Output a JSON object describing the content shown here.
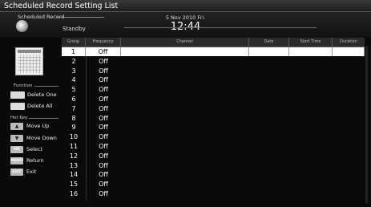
{
  "window": {
    "title": "Scheduled Record Setting List"
  },
  "header": {
    "label": "Scheduled Record",
    "status": "Standby",
    "date": "5 Nov 2010 Fri.",
    "time": "12:44"
  },
  "sidebar": {
    "function_label": "Function",
    "functions": [
      {
        "label": "Delete One"
      },
      {
        "label": "Delete All"
      }
    ],
    "hotkey_label": "Hot Key",
    "hotkeys": [
      {
        "key": "▲",
        "label": "Move Up"
      },
      {
        "key": "▼",
        "label": "Move Down"
      },
      {
        "key": "OK",
        "label": "Select"
      },
      {
        "key": "MENU",
        "label": "Return"
      },
      {
        "key": "EXIT",
        "label": "Exit"
      }
    ]
  },
  "table": {
    "columns": [
      "Group",
      "Frequency",
      "Channel",
      "Date",
      "Start Time",
      "Duration"
    ],
    "rows": [
      {
        "group": "1",
        "frequency": "Off"
      },
      {
        "group": "2",
        "frequency": "Off"
      },
      {
        "group": "3",
        "frequency": "Off"
      },
      {
        "group": "4",
        "frequency": "Off"
      },
      {
        "group": "5",
        "frequency": "Off"
      },
      {
        "group": "6",
        "frequency": "Off"
      },
      {
        "group": "7",
        "frequency": "Off"
      },
      {
        "group": "8",
        "frequency": "Off"
      },
      {
        "group": "9",
        "frequency": "Off"
      },
      {
        "group": "10",
        "frequency": "Off"
      },
      {
        "group": "11",
        "frequency": "Off"
      },
      {
        "group": "12",
        "frequency": "Off"
      },
      {
        "group": "13",
        "frequency": "Off"
      },
      {
        "group": "14",
        "frequency": "Off"
      },
      {
        "group": "15",
        "frequency": "Off"
      },
      {
        "group": "16",
        "frequency": "Off"
      }
    ],
    "selected_index": 0
  }
}
